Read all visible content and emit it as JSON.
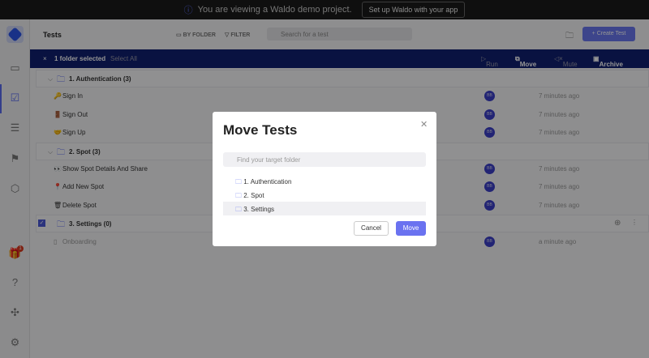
{
  "banner": {
    "text": "You are viewing a Waldo demo project.",
    "button": "Set up Waldo with your app"
  },
  "header": {
    "title": "Tests",
    "by_folder": "BY FOLDER",
    "filter": "FILTER",
    "search_placeholder": "Search for a test",
    "create": "Create Test"
  },
  "selection": {
    "count": "1 folder selected",
    "select_all": "Select All",
    "run": "Run",
    "move": "Move",
    "mute": "Mute",
    "archive": "Archive"
  },
  "sidebar": {
    "badge": "1"
  },
  "rows": [
    {
      "type": "folder",
      "label": "1. Authentication (3)"
    },
    {
      "type": "test",
      "icon": "🔑",
      "label": "Sign In",
      "avatar": "BB",
      "time": "7 minutes ago"
    },
    {
      "type": "test",
      "icon": "🚪",
      "label": "Sign Out",
      "avatar": "BB",
      "time": "7 minutes ago"
    },
    {
      "type": "test",
      "icon": "🤝",
      "label": "Sign Up",
      "avatar": "BB",
      "time": "7 minutes ago"
    },
    {
      "type": "folder",
      "label": "2. Spot (3)"
    },
    {
      "type": "test",
      "icon": "👀",
      "label": "Show Spot Details And Share",
      "avatar": "BB",
      "time": "7 minutes ago"
    },
    {
      "type": "test",
      "icon": "📍",
      "label": "Add New Spot",
      "avatar": "BB",
      "time": "7 minutes ago"
    },
    {
      "type": "test",
      "icon": "🗑",
      "label": "Delete Spot",
      "avatar": "BB",
      "time": "7 minutes ago"
    },
    {
      "type": "folder",
      "label": "3. Settings (0)",
      "checked": true
    },
    {
      "type": "test",
      "icon": "▯",
      "label": "Onboarding",
      "avatar": "BB",
      "time": "a minute ago"
    }
  ],
  "modal": {
    "title": "Move Tests",
    "search_placeholder": "Find your target folder",
    "folders": [
      "1. Authentication",
      "2. Spot",
      "3. Settings"
    ],
    "cancel": "Cancel",
    "move": "Move"
  }
}
